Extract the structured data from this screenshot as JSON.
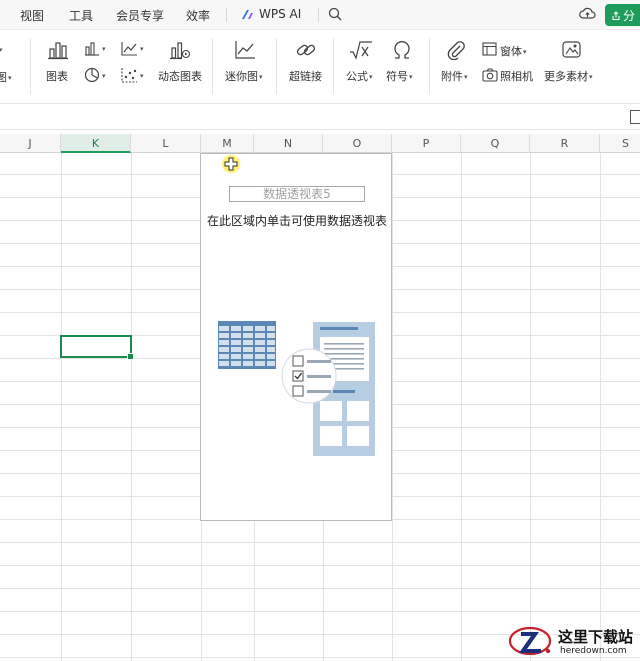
{
  "menubar": {
    "items": [
      "视图",
      "工具",
      "会员专享",
      "效率"
    ],
    "wps_ai": "WPS AI",
    "share_label": "分"
  },
  "ribbon": {
    "left_partial_label": "图",
    "chart_label": "图表",
    "dynamic_chart_label": "动态图表",
    "sparkline_label": "迷你图",
    "hyperlink_label": "超链接",
    "formula_label": "公式",
    "symbol_label": "符号",
    "attachment_label": "附件",
    "window_label": "窗体",
    "camera_label": "照相机",
    "more_material_label": "更多素材"
  },
  "columns": [
    "J",
    "K",
    "L",
    "M",
    "N",
    "O",
    "P",
    "Q",
    "R",
    "S"
  ],
  "active_column": "K",
  "pivot": {
    "name": "数据透视表5",
    "hint": "在此区域内单击可使用数据透视表"
  },
  "watermark": {
    "title": "这里下载站",
    "domain": "heredown.com"
  },
  "colors": {
    "accent": "#1e9c5b",
    "illustration_blue": "#5b87b4",
    "illustration_light": "#b7cee2"
  }
}
